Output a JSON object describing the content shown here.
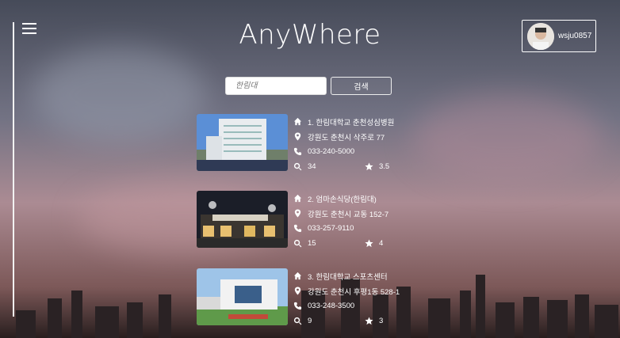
{
  "app": {
    "title": "AnyWhere"
  },
  "user": {
    "name": "wsju0857"
  },
  "search": {
    "placeholder": "한림대",
    "button_label": "검색"
  },
  "results": [
    {
      "name": "1. 한림대학교 춘천성심병원",
      "address": "강원도 춘천시 삭주로 77",
      "phone": "033-240-5000",
      "views": "34",
      "rating": "3.5"
    },
    {
      "name": "2. 엄마손식당(한림대)",
      "address": "강원도 춘천시 교동 152-7",
      "phone": "033-257-9110",
      "views": "15",
      "rating": "4"
    },
    {
      "name": "3. 한림대학교 스포츠센터",
      "address": "강원도 춘천시 후평1동 528-1",
      "phone": "033-248-3500",
      "views": "9",
      "rating": "3"
    }
  ],
  "icons": {
    "menu": "menu-icon",
    "home": "home-icon",
    "location": "map-pin-icon",
    "phone": "phone-icon",
    "search": "search-icon",
    "star": "star-icon"
  }
}
